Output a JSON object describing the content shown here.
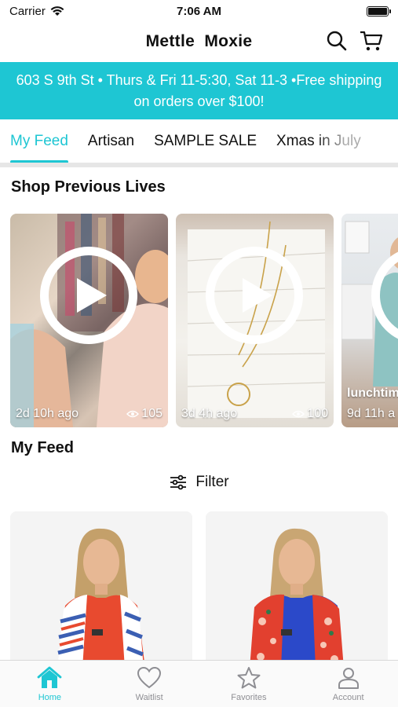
{
  "status_bar": {
    "carrier": "Carrier",
    "time": "7:06 AM"
  },
  "header": {
    "title": "Mettle  Moxie",
    "icons": [
      "search-icon",
      "cart-icon"
    ]
  },
  "banner": {
    "text": "603 S 9th St • Thurs & Fri 11-5:30, Sat 11-3 •Free shipping on orders over $100!"
  },
  "tabs": [
    {
      "label": "My Feed",
      "active": true
    },
    {
      "label": "Artisan"
    },
    {
      "label": "SAMPLE SALE"
    },
    {
      "label": "Xmas in July"
    }
  ],
  "previous_lives": {
    "title": "Shop Previous Lives",
    "items": [
      {
        "ago": "2d 10h ago",
        "views": "105"
      },
      {
        "ago": "3d 4h ago",
        "views": "100"
      },
      {
        "title": "lunchtim",
        "ago": "9d 11h a"
      }
    ]
  },
  "feed": {
    "title": "My Feed",
    "filter_label": "Filter"
  },
  "colors": {
    "accent": "#1ec6d3"
  },
  "tab_bar": [
    {
      "label": "Home",
      "icon": "home-icon",
      "active": true
    },
    {
      "label": "Waitlist",
      "icon": "heart-icon"
    },
    {
      "label": "Favorites",
      "icon": "star-icon"
    },
    {
      "label": "Account",
      "icon": "account-icon"
    }
  ]
}
